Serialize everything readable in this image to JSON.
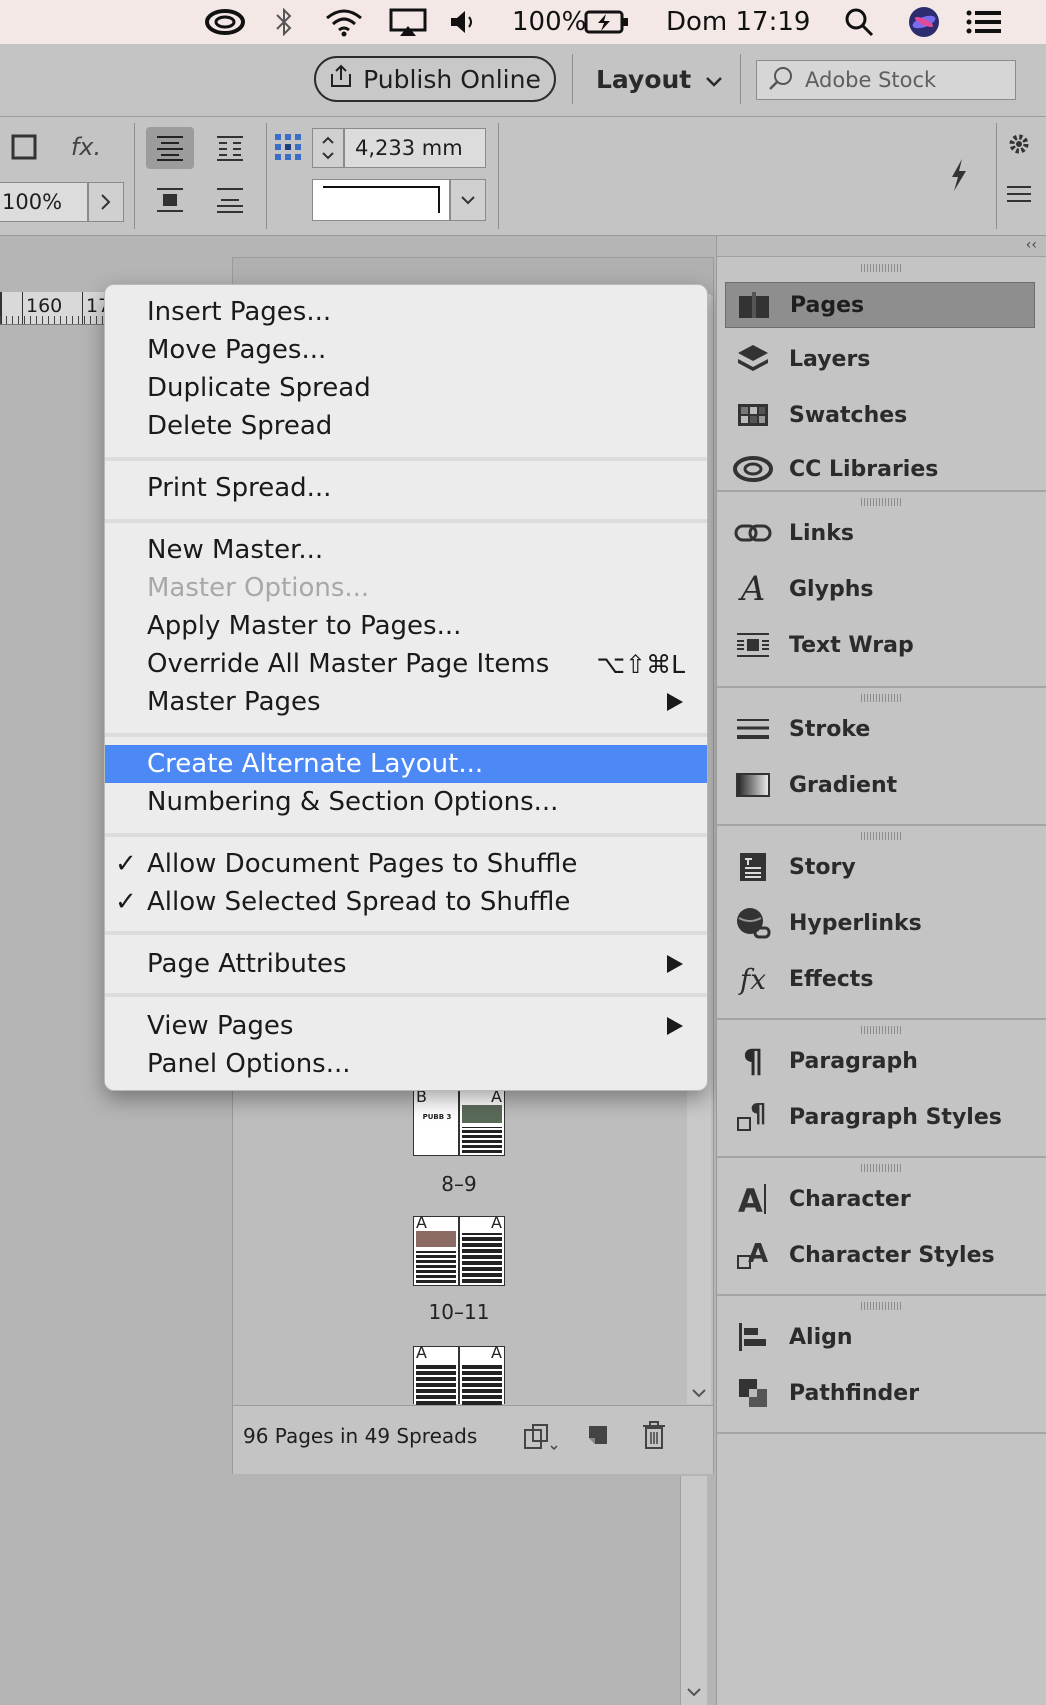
{
  "menubar": {
    "battery": "100%",
    "clock": "Dom 17:19"
  },
  "appbar": {
    "publish_label": "Publish Online",
    "workspace_label": "Layout",
    "search_placeholder": "Adobe Stock"
  },
  "control": {
    "fx_label": "fx.",
    "zoom_value": "100%",
    "spacing_value": "4,233 mm"
  },
  "ruler": {
    "tick_1": "160",
    "tick_2": "17"
  },
  "context_menu": {
    "items": [
      {
        "label": "Insert Pages..."
      },
      {
        "label": "Move Pages..."
      },
      {
        "label": "Duplicate Spread"
      },
      {
        "label": "Delete Spread"
      },
      {
        "label": "Print Spread..."
      },
      {
        "label": "New Master..."
      },
      {
        "label": "Master Options..."
      },
      {
        "label": "Apply Master to Pages..."
      },
      {
        "label": "Override All Master Page Items",
        "shortcut": "⌥⇧⌘L"
      },
      {
        "label": "Master Pages"
      },
      {
        "label": "Create Alternate Layout..."
      },
      {
        "label": "Numbering & Section Options..."
      },
      {
        "label": "Allow Document Pages to Shuffle",
        "check": "✓"
      },
      {
        "label": "Allow Selected Spread to Shuffle",
        "check": "✓"
      },
      {
        "label": "Page Attributes"
      },
      {
        "label": "View Pages"
      },
      {
        "label": "Panel Options..."
      }
    ]
  },
  "pages_panel": {
    "spreads": [
      {
        "label": "8–9",
        "left_master": "B",
        "right_master": "A",
        "thumb_text": "PUBB 3"
      },
      {
        "label": "10–11",
        "left_master": "A",
        "right_master": "A"
      },
      {
        "left_master": "A",
        "right_master": "A"
      }
    ],
    "footer_text": "96 Pages in 49 Spreads"
  },
  "dock": {
    "items": [
      {
        "label": "Pages"
      },
      {
        "label": "Layers"
      },
      {
        "label": "Swatches"
      },
      {
        "label": "CC Libraries"
      },
      {
        "label": "Links"
      },
      {
        "label": "Glyphs"
      },
      {
        "label": "Text Wrap"
      },
      {
        "label": "Stroke"
      },
      {
        "label": "Gradient"
      },
      {
        "label": "Story"
      },
      {
        "label": "Hyperlinks"
      },
      {
        "label": "Effects"
      },
      {
        "label": "Paragraph"
      },
      {
        "label": "Paragraph Styles"
      },
      {
        "label": "Character"
      },
      {
        "label": "Character Styles"
      },
      {
        "label": "Align"
      },
      {
        "label": "Pathfinder"
      }
    ]
  },
  "colors": {
    "highlight": "#4d89f5",
    "menubar_bg": "#f3e8e6",
    "app_bg": "#c4c4c4"
  }
}
